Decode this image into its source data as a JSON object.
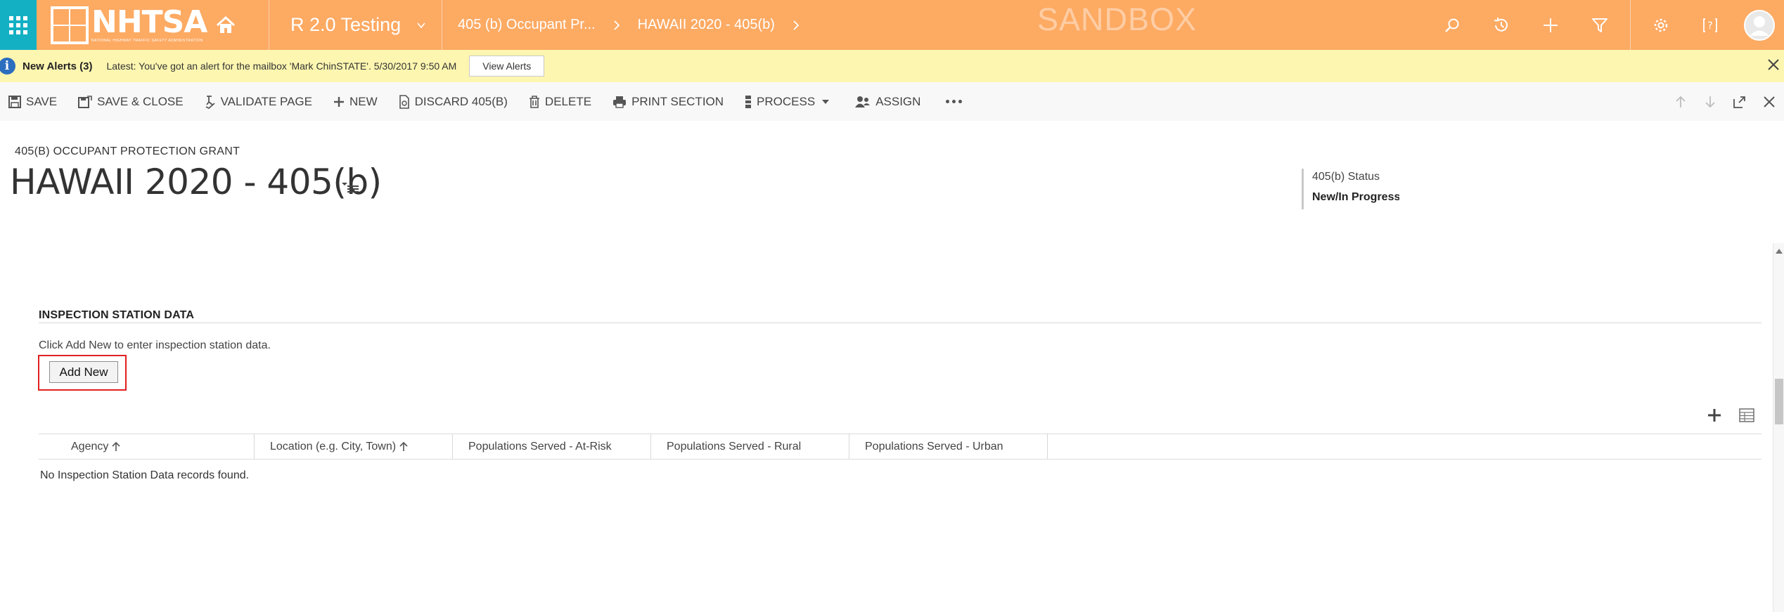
{
  "nav": {
    "logo_text": "NHTSA",
    "logo_subtext": "NATIONAL HIGHWAY TRAFFIC SAFETY ADMINISTRATION",
    "app_name": "R 2.0 Testing",
    "breadcrumbs": [
      "405 (b) Occupant Pr...",
      "HAWAII 2020 - 405(b)"
    ],
    "environment_label": "SANDBOX",
    "icons": [
      "waffle-icon",
      "home-icon",
      "search-icon",
      "history-icon",
      "plus-icon",
      "filter-icon",
      "gear-icon",
      "help-icon",
      "user-avatar-icon"
    ],
    "colors": {
      "nav_bg": "#fdaa63",
      "waffle_bg": "#13b0c4"
    }
  },
  "alerts": {
    "title": "New Alerts (3)",
    "message": "Latest: You've got an alert for the mailbox 'Mark ChinSTATE'. 5/30/2017 9:50 AM",
    "button": "View Alerts",
    "bg_color": "#fdf6b0"
  },
  "commands": {
    "save": "SAVE",
    "save_close": "SAVE & CLOSE",
    "validate": "VALIDATE PAGE",
    "new": "NEW",
    "discard": "DISCARD 405(B)",
    "delete": "DELETE",
    "print": "PRINT SECTION",
    "process": "PROCESS",
    "assign": "ASSIGN"
  },
  "header": {
    "entity_type": "405(B) OCCUPANT PROTECTION GRANT",
    "title": "HAWAII 2020 - 405(b)",
    "status_label": "405(b) Status",
    "status_value": "New/In Progress"
  },
  "section": {
    "title": "INSPECTION STATION DATA",
    "description": "Click Add New to enter inspection station data.",
    "add_new_button": "Add New"
  },
  "grid": {
    "columns": [
      "Agency",
      "Location (e.g. City, Town)",
      "Populations Served - At-Risk",
      "Populations Served - Rural",
      "Populations Served - Urban"
    ],
    "sorted_columns": [
      "Agency",
      "Location (e.g. City, Town)"
    ],
    "empty_message": "No Inspection Station Data records found."
  }
}
